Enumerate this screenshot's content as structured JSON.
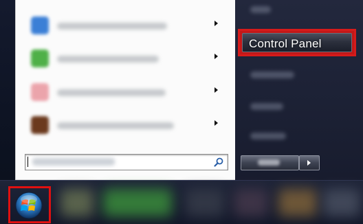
{
  "start_menu": {
    "right_panel": {
      "control_panel_label": "Control Panel"
    }
  },
  "colors": {
    "highlight_red": "#d61b1b",
    "left_panel_bg": "#fbfbfb",
    "right_panel_bg": "#1d2236",
    "taskbar_bg": "#13182a"
  },
  "icons": {
    "search": "magnifier-icon",
    "start": "windows-orb-icon",
    "submenu_arrow": "chevron-right-icon"
  }
}
